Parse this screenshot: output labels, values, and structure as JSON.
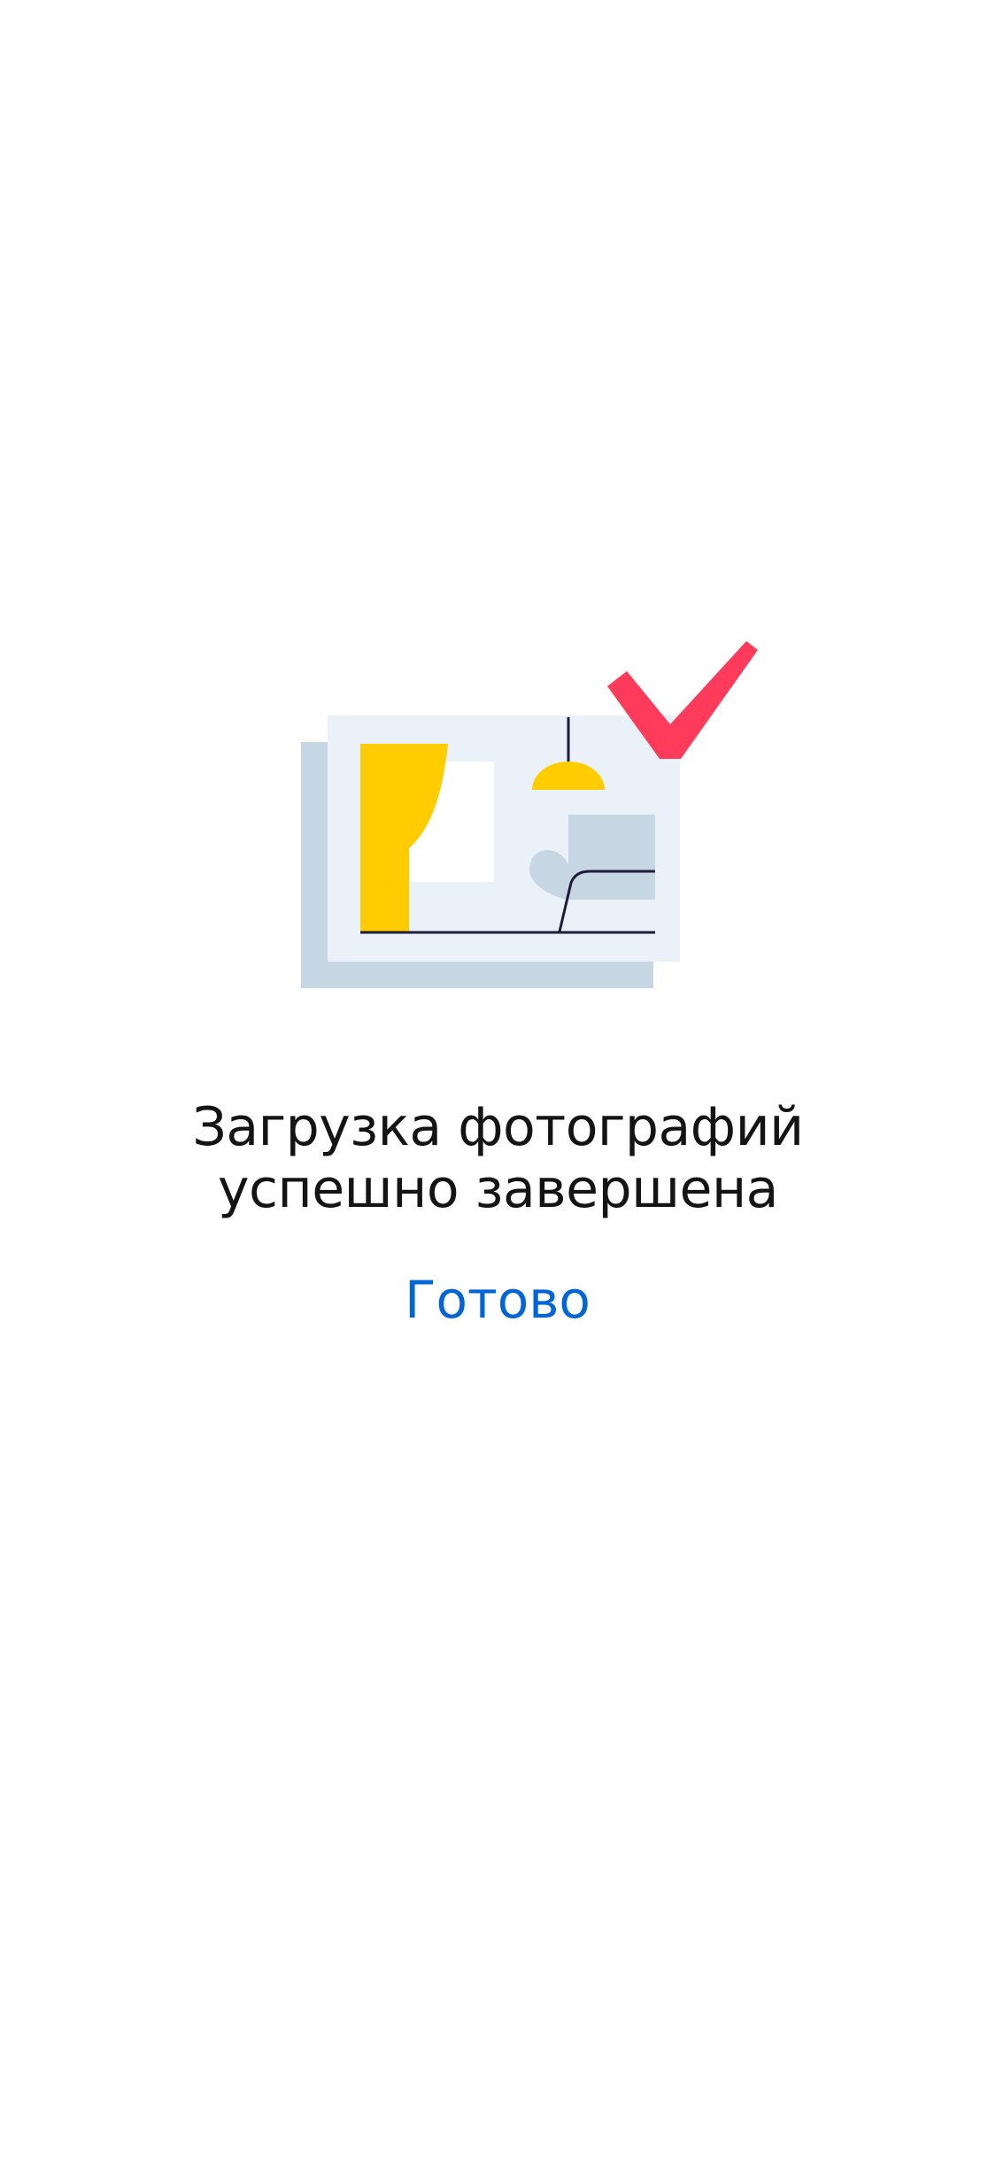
{
  "illustration": {
    "icon": "photo-upload-success-illustration",
    "colors": {
      "back_photo": "#c7d6e3",
      "front_photo": "#ebf1f8",
      "curtain": "#ffcc00",
      "lamp": "#ffcc00",
      "line": "#1f1d3a",
      "sofa": "#c7d6e3",
      "checkmark": "#ff3b5c"
    }
  },
  "message": {
    "line1": "Загрузка фотографий",
    "line2": "успешно завершена"
  },
  "actions": {
    "done_label": "Готово"
  },
  "colors": {
    "text": "#141414",
    "accent": "#0066d6",
    "background": "#ffffff"
  }
}
